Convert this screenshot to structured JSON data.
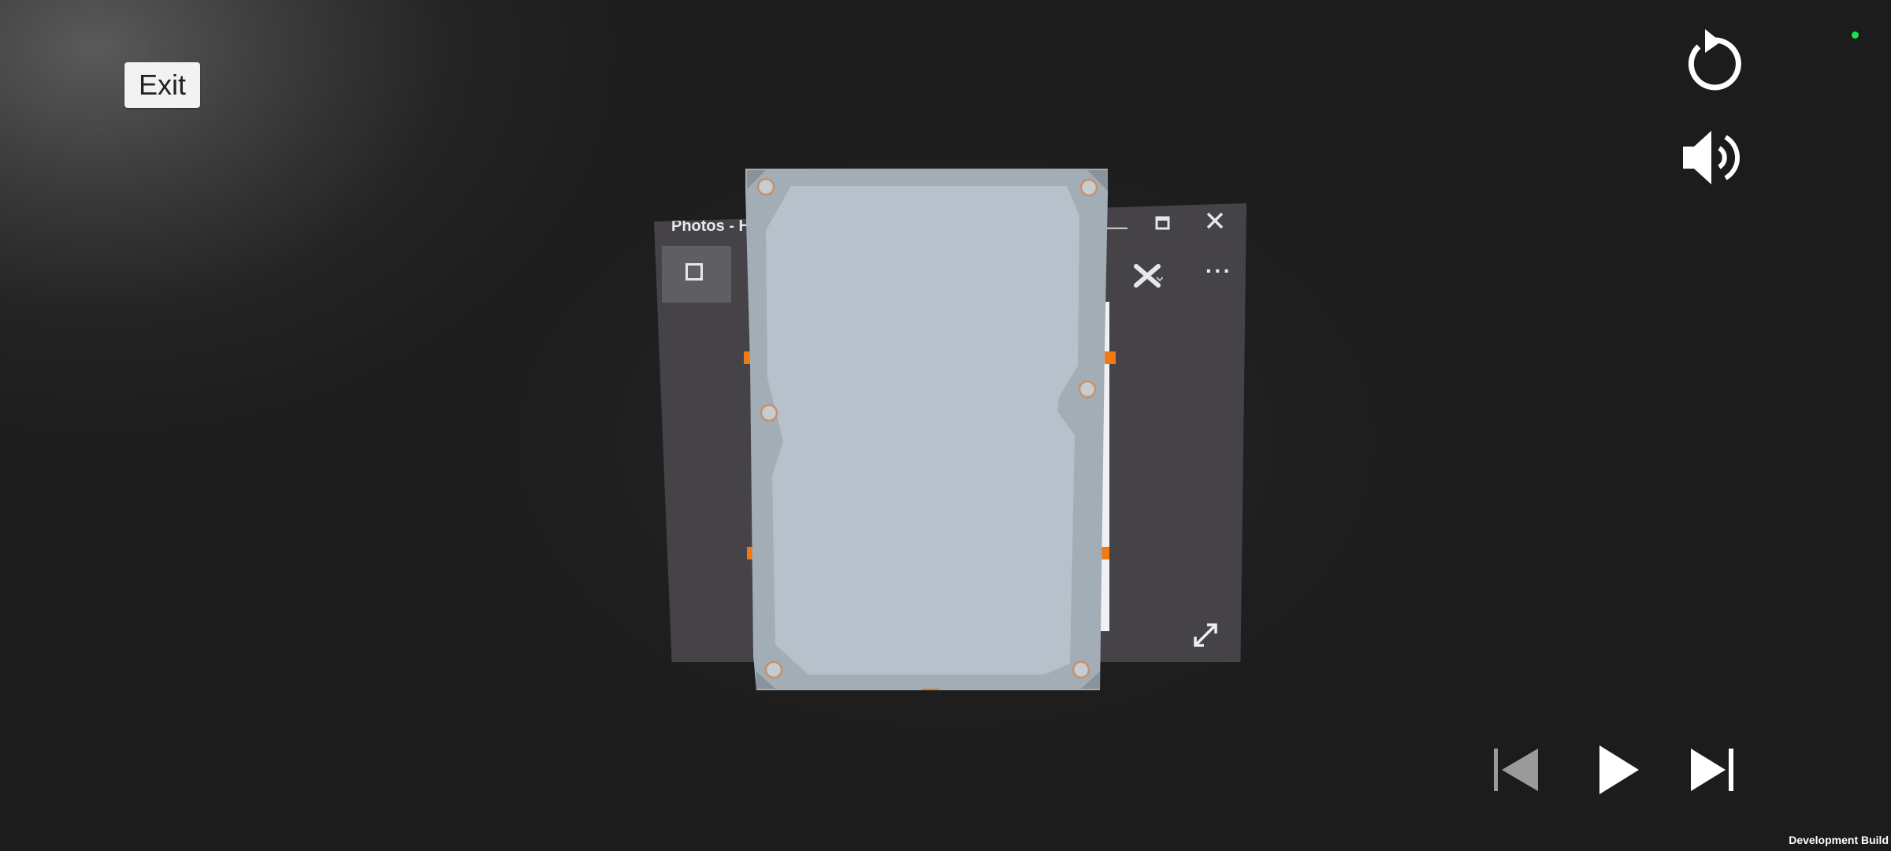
{
  "controls": {
    "exit_label": "Exit",
    "reload_icon": "reload-icon",
    "volume_icon": "volume-icon",
    "prev_icon": "skip-previous-icon",
    "play_icon": "play-icon",
    "next_icon": "skip-next-icon"
  },
  "window": {
    "title": "Photos - HD",
    "more_label": "···"
  },
  "footer": {
    "build_label": "Development Build"
  },
  "colors": {
    "status_dot": "#1ee04a",
    "accent_orange": "#f07b12",
    "hdd_body": "#b6c0ca",
    "hdd_frame": "#a3adb6"
  }
}
